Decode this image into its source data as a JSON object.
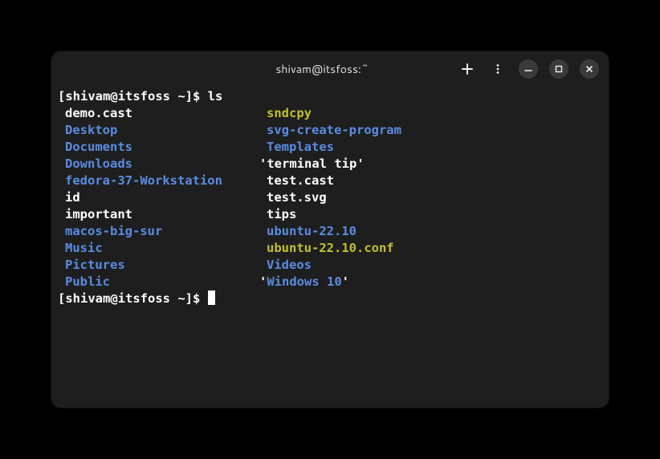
{
  "title": "shivam@itsfoss:~",
  "prompt": {
    "open": "[",
    "userhost": "shivam@itsfoss",
    "path": " ~",
    "close": "]$ "
  },
  "command": "ls",
  "listing": [
    [
      {
        "text": "demo.cast",
        "type": "file"
      },
      {
        "text": "sndcpy",
        "type": "exec"
      }
    ],
    [
      {
        "text": "Desktop",
        "type": "dir"
      },
      {
        "text": "svg-create-program",
        "type": "dir"
      }
    ],
    [
      {
        "text": "Documents",
        "type": "dir"
      },
      {
        "text": "Templates",
        "type": "dir"
      }
    ],
    [
      {
        "text": "Downloads",
        "type": "dir"
      },
      {
        "text": "'terminal tip'",
        "type": "file",
        "quoted": true
      }
    ],
    [
      {
        "text": "fedora-37-Workstation",
        "type": "dir"
      },
      {
        "text": "test.cast",
        "type": "file"
      }
    ],
    [
      {
        "text": "id",
        "type": "file"
      },
      {
        "text": "test.svg",
        "type": "file"
      }
    ],
    [
      {
        "text": "important",
        "type": "file"
      },
      {
        "text": "tips",
        "type": "file"
      }
    ],
    [
      {
        "text": "macos-big-sur",
        "type": "dir"
      },
      {
        "text": "ubuntu-22.10",
        "type": "dir"
      }
    ],
    [
      {
        "text": "Music",
        "type": "dir"
      },
      {
        "text": "ubuntu-22.10.conf",
        "type": "exec"
      }
    ],
    [
      {
        "text": "Pictures",
        "type": "dir"
      },
      {
        "text": "Videos",
        "type": "dir"
      }
    ],
    [
      {
        "text": "Public",
        "type": "dir"
      },
      {
        "text": "'Windows 10'",
        "type": "dir",
        "quoted": true
      }
    ]
  ]
}
